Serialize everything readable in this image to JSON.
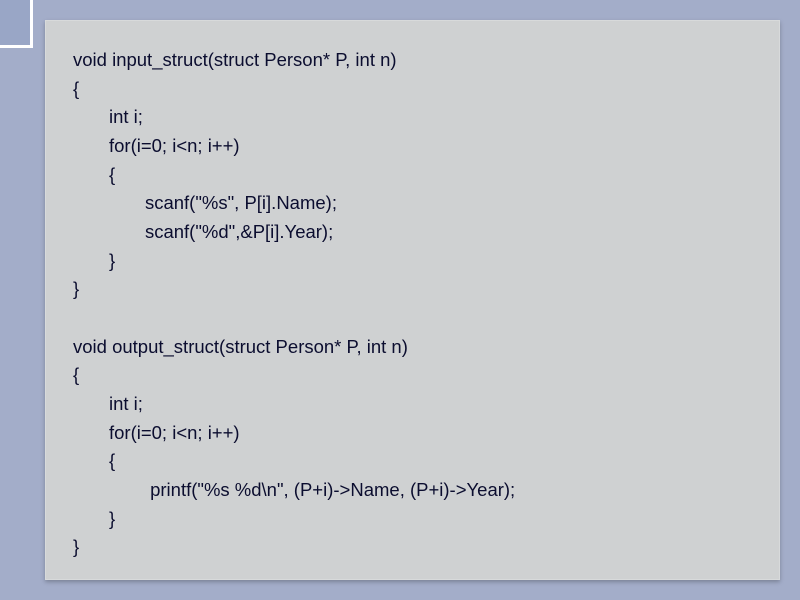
{
  "code": {
    "lines": [
      "void input_struct(struct Person* P, int n)",
      "{",
      "       int i;",
      "       for(i=0; i<n; i++)",
      "       {",
      "              scanf(\"%s\", P[i].Name);",
      "              scanf(\"%d\",&P[i].Year);",
      "       }",
      "}",
      "",
      "void output_struct(struct Person* P, int n)",
      "{",
      "       int i;",
      "       for(i=0; i<n; i++)",
      "       {",
      "               printf(\"%s %d\\n\", (P+i)->Name, (P+i)->Year);",
      "       }",
      "}"
    ]
  }
}
